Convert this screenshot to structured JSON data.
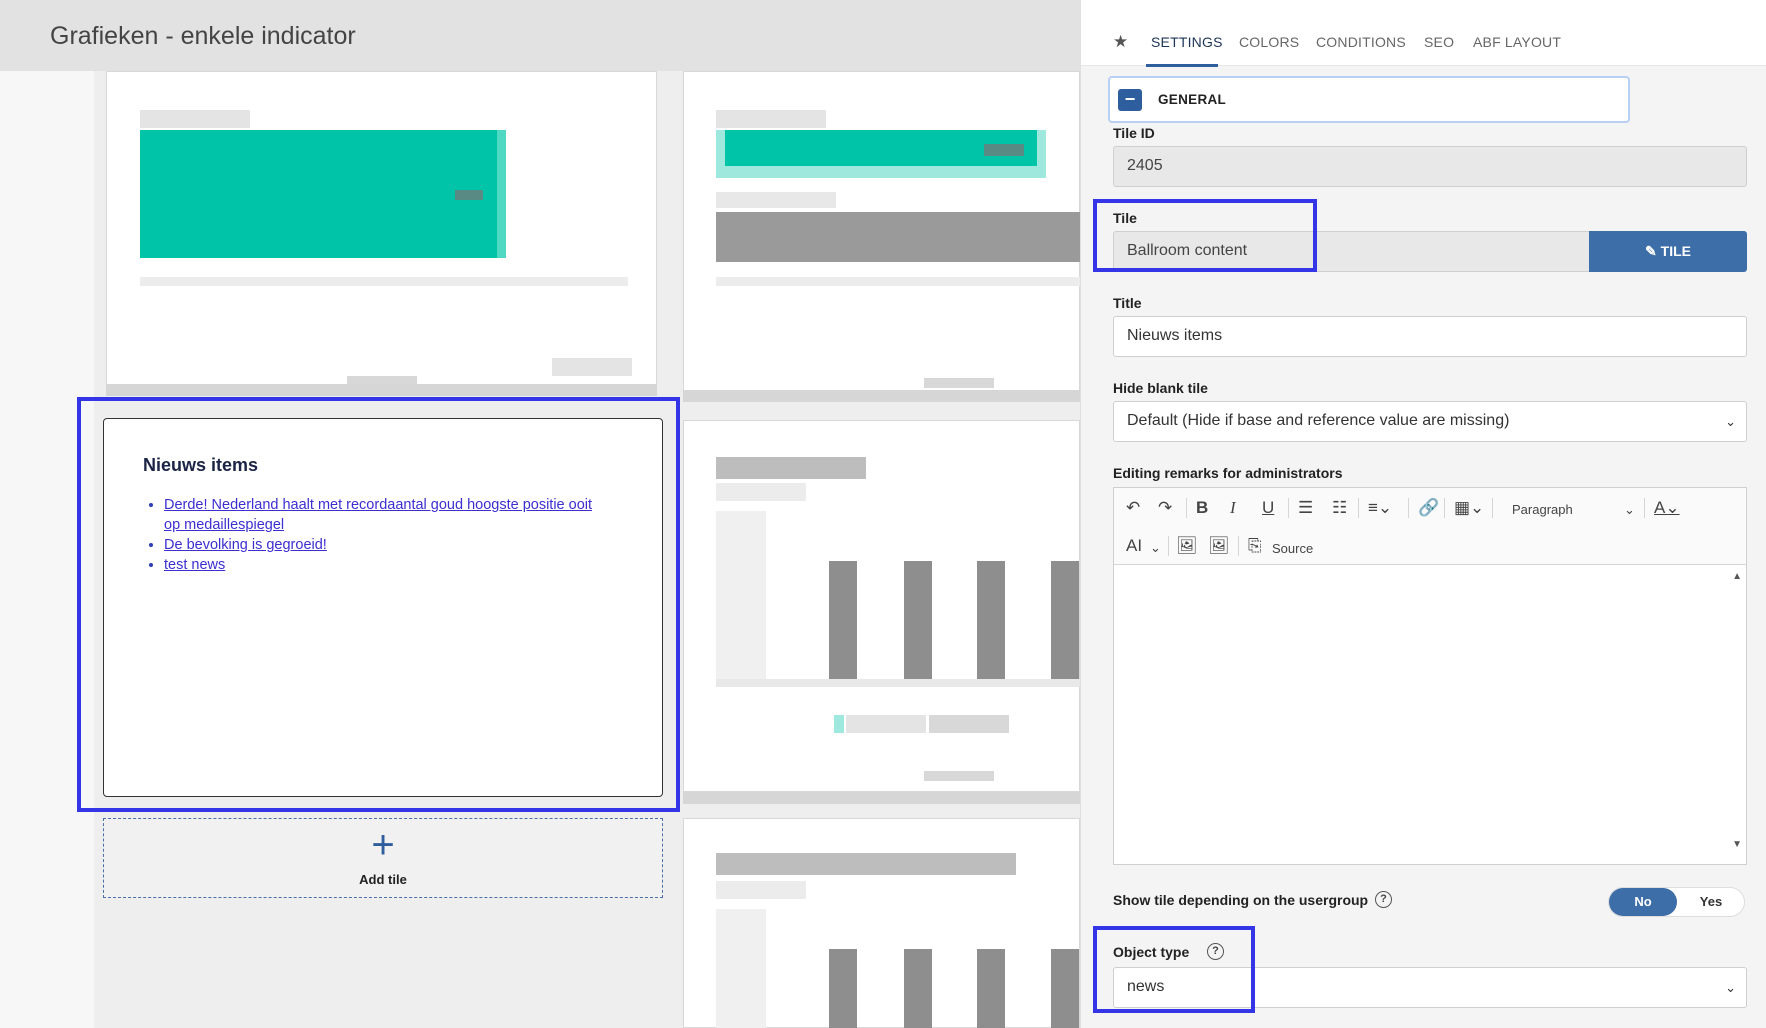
{
  "page": {
    "title": "Grafieken - enkele indicator"
  },
  "news_tile": {
    "heading": "Nieuws items",
    "items": [
      "Derde! Nederland haalt met recordaantal goud hoogste positie ooit op medaillespiegel",
      "De bevolking is gegroeid!",
      "test news"
    ]
  },
  "add_tile": {
    "label": "Add tile"
  },
  "panel": {
    "tabs": [
      "SETTINGS",
      "COLORS",
      "CONDITIONS",
      "SEO",
      "ABF LAYOUT"
    ],
    "active_tab": "SETTINGS",
    "section": "GENERAL",
    "tile_id": {
      "label": "Tile ID",
      "value": "2405"
    },
    "tile": {
      "label": "Tile",
      "value": "Ballroom content",
      "button": "TILE"
    },
    "title": {
      "label": "Title",
      "value": "Nieuws items"
    },
    "hide_blank": {
      "label": "Hide blank tile",
      "value": "Default (Hide if base and reference value are missing)"
    },
    "remarks": {
      "label": "Editing remarks for administrators",
      "paragraph": "Paragraph",
      "source": "Source",
      "ai": "AI"
    },
    "usergroup": {
      "label": "Show tile depending on the usergroup",
      "no": "No",
      "yes": "Yes",
      "selected": "No"
    },
    "object_type": {
      "label": "Object type",
      "value": "news"
    }
  },
  "colors": {
    "accent": "#3e6ea8",
    "highlight": "#3535e8",
    "teal": "#00c4a7"
  }
}
